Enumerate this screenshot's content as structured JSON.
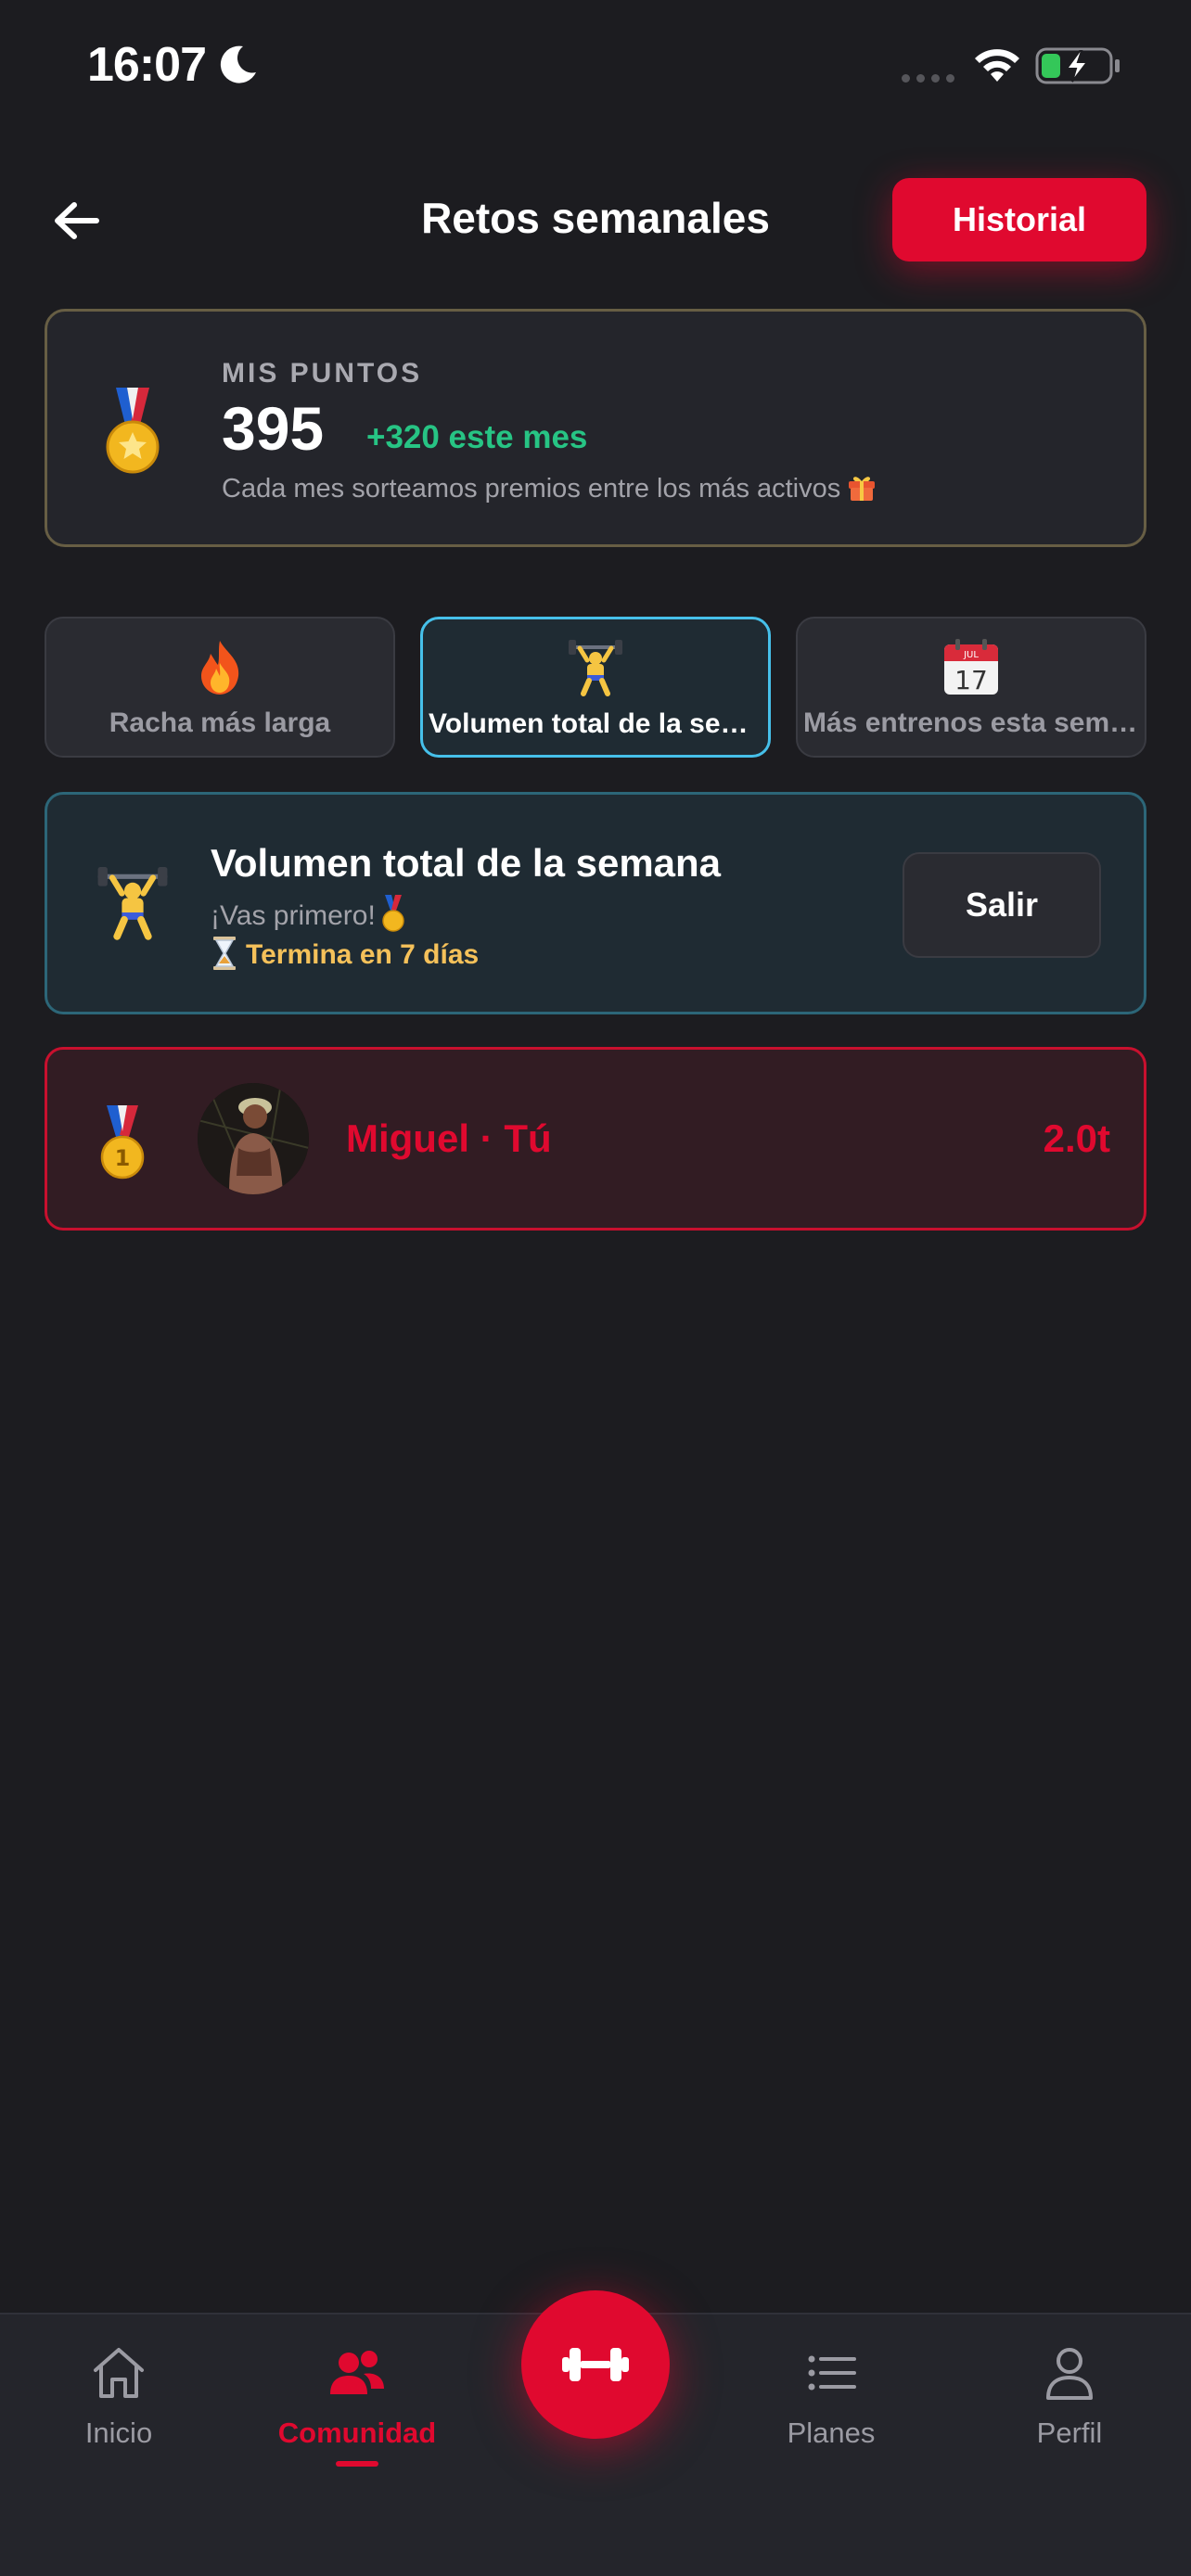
{
  "status_bar": {
    "time": "16:07",
    "icons": [
      "moon-icon",
      "cellular-signal-icon",
      "wifi-icon",
      "battery-charging-icon"
    ]
  },
  "header": {
    "title": "Retos semanales",
    "history_button": "Historial"
  },
  "points": {
    "label": "MIS PUNTOS",
    "value": "395",
    "delta": "+320 este mes",
    "note": "Cada mes sorteamos premios entre los más activos"
  },
  "tabs": [
    {
      "icon": "fire-icon",
      "label": "Racha más larga",
      "active": false
    },
    {
      "icon": "weightlifter-icon",
      "label": "Volumen total de la semana",
      "active": true
    },
    {
      "icon": "calendar-icon",
      "label": "Más entrenos esta semana",
      "active": false
    }
  ],
  "challenge": {
    "title": "Volumen total de la semana",
    "rank_text": "¡Vas primero!",
    "timer": "Termina en 7 días",
    "leave_button": "Salir"
  },
  "leaderboard": [
    {
      "rank": 1,
      "name": "Miguel · Tú",
      "score": "2.0t"
    }
  ],
  "nav": {
    "items": [
      {
        "label": "Inicio",
        "icon": "home-icon"
      },
      {
        "label": "Comunidad",
        "icon": "community-icon",
        "active": true
      },
      {
        "label": "Planes",
        "icon": "list-icon"
      },
      {
        "label": "Perfil",
        "icon": "profile-icon"
      }
    ],
    "center_button_icon": "dumbbell-icon"
  },
  "colors": {
    "background": "#1c1c20",
    "accent": "#e0092f",
    "positive": "#27c484",
    "timer": "#f5c15a",
    "active_tab_border": "#46c0ea"
  }
}
